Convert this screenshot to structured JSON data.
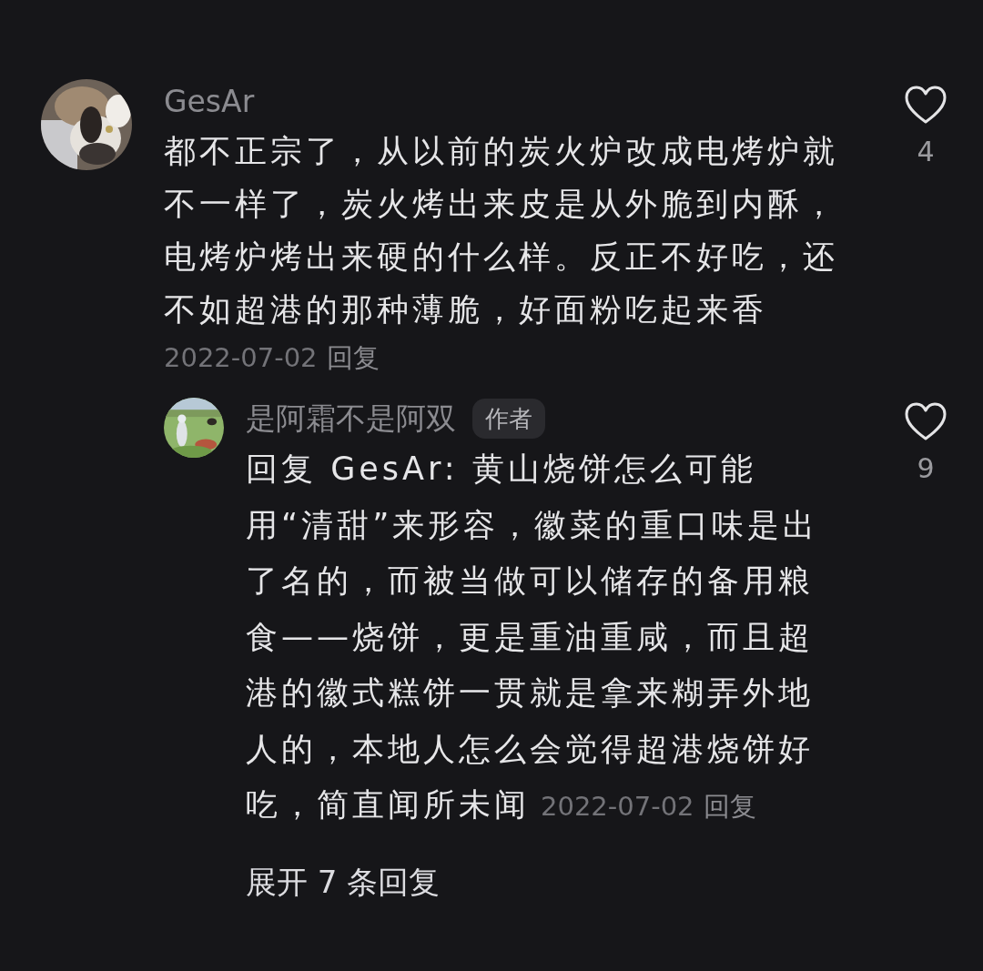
{
  "comments": [
    {
      "user": "GesAr",
      "text": "都不正宗了，从以前的炭火炉改成电烤炉就不一样了，炭火烤出来皮是从外脆到内酥，电烤炉烤出来硬的什么样。反正不好吃，还不如超港的那种薄脆，好面粉吃起来香",
      "date": "2022-07-02",
      "reply_label": "回复",
      "likes": "4",
      "replies": [
        {
          "user": "是阿霜不是阿双",
          "badge": "作者",
          "text": "回复 GesAr: 黄山烧饼怎么可能用“清甜”来形容，徽菜的重口味是出了名的，而被当做可以储存的备用粮食——烧饼，更是重油重咸，而且超港的徽式糕饼一贯就是拿来糊弄外地人的，本地人怎么会觉得超港烧饼好吃，简直闻所未闻",
          "date": "2022-07-02",
          "reply_label": "回复",
          "likes": "9"
        }
      ],
      "expand_label": "展开 7 条回复"
    }
  ]
}
